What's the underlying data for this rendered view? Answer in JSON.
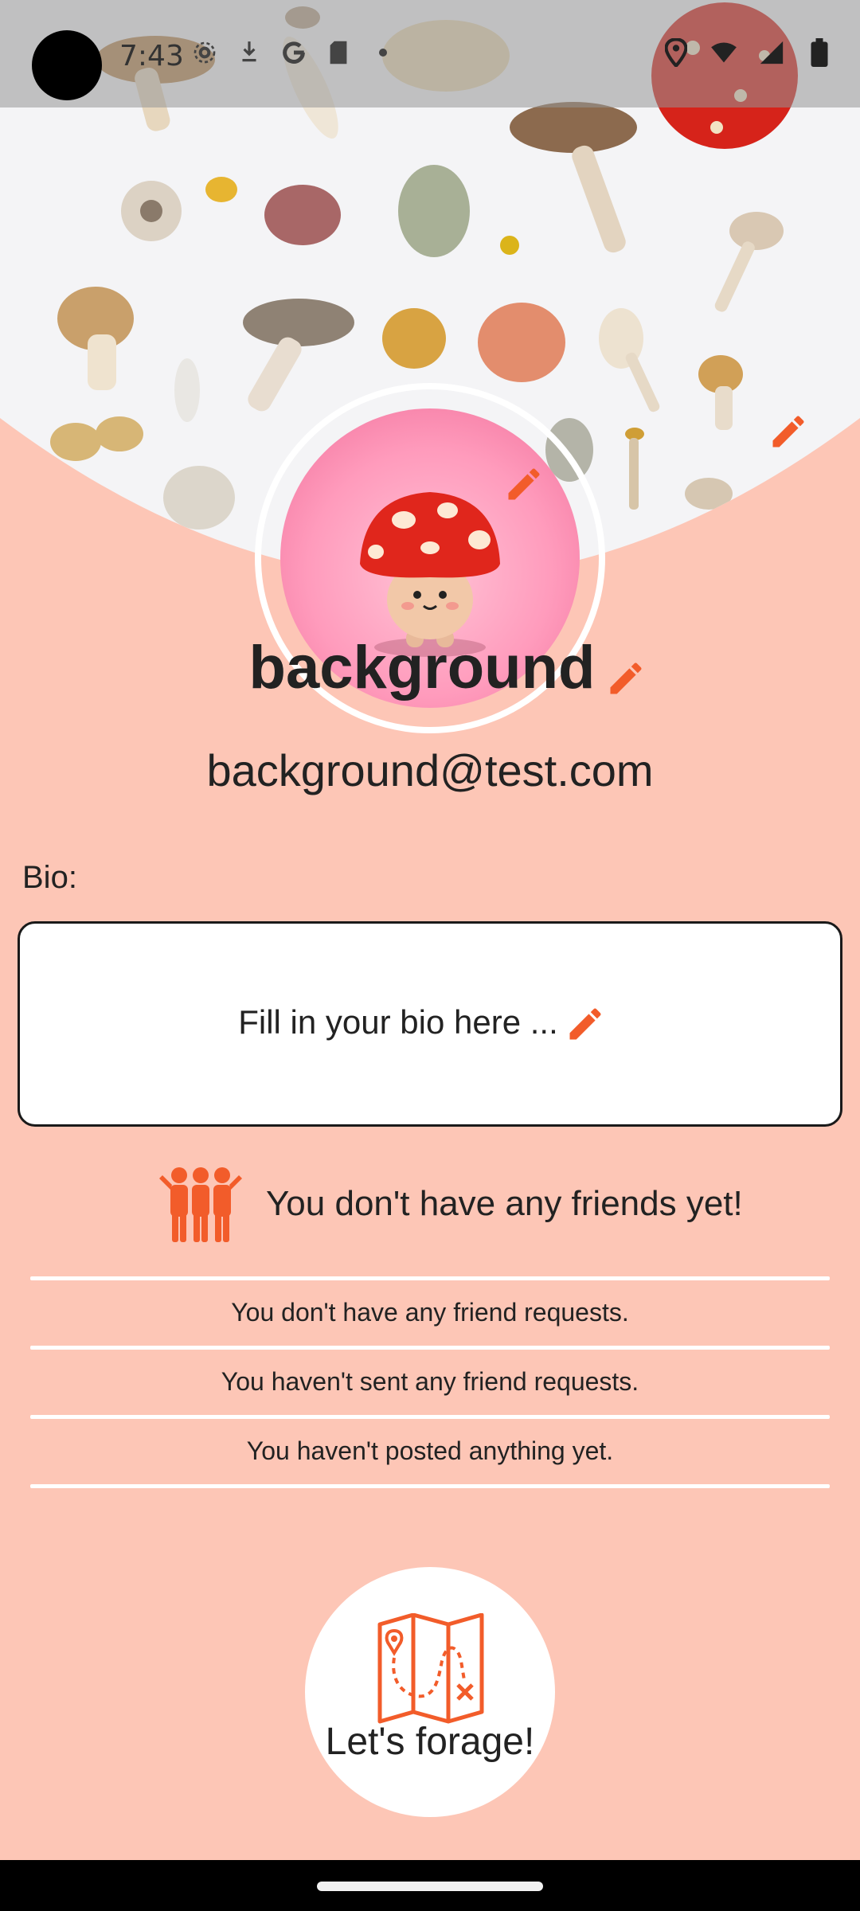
{
  "status_bar": {
    "time": "7:43",
    "left_icons": [
      "settings-icon",
      "download-icon",
      "google-icon",
      "sd-card-icon",
      "dot-icon"
    ],
    "right_icons": [
      "location-icon",
      "wifi-icon",
      "signal-icon",
      "battery-icon"
    ]
  },
  "profile": {
    "username": "background",
    "email": "background@test.com",
    "bio_label": "Bio:",
    "bio_placeholder": "Fill in your bio here ..."
  },
  "friends": {
    "message": "You don't have any friends yet!",
    "icon": "friends-group-icon"
  },
  "activity": {
    "friend_requests": "You don't have any friend requests.",
    "sent_requests": "You haven't sent any friend requests.",
    "posts": "You haven't posted anything yet."
  },
  "forage_button": {
    "label": "Let's forage!",
    "icon": "treasure-map-icon"
  },
  "colors": {
    "background": "#fdc6b6",
    "accent": "#f25c2a",
    "card": "#ffffff"
  }
}
